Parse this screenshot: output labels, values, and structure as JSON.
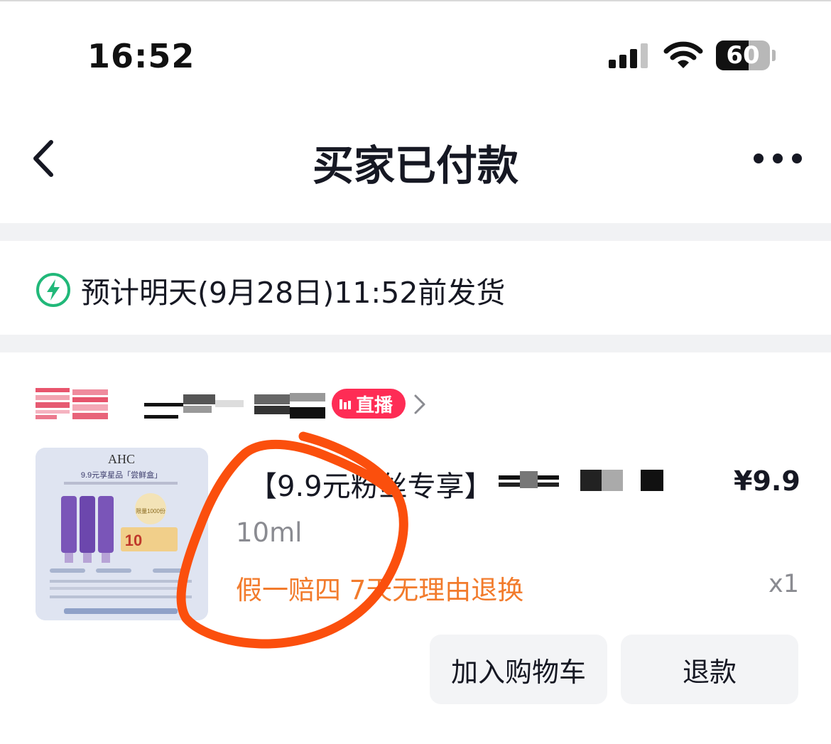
{
  "status_bar": {
    "time": "16:52",
    "battery": "60",
    "battery_level": 0.6,
    "signal_icon": "cellular-signal-icon",
    "wifi_icon": "wifi-icon"
  },
  "nav": {
    "title": "买家已付款",
    "back_icon": "chevron-left-icon",
    "more_icon": "more-dots-icon"
  },
  "shipping": {
    "icon": "lightning-bolt-icon",
    "text": "预计明天(9月28日)11:52前发货"
  },
  "shop": {
    "live_badge": "直播",
    "chevron_icon": "chevron-right-icon"
  },
  "product": {
    "image_brand": "AHC",
    "image_promo": "9.9元享星品「尝鲜盒」",
    "image_limit": "限量1000份",
    "image_coupon": "10",
    "title": "【9.9元粉丝专享】",
    "price": "¥9.9",
    "spec": "10ml",
    "tags": "假一赔四  7天无理由退换",
    "quantity": "x1"
  },
  "actions": {
    "add_to_cart": "加入购物车",
    "refund": "退款"
  },
  "colors": {
    "accent_red": "#fe2c55",
    "tag_orange": "#f27b2c",
    "bolt_green": "#21b879",
    "annotation_orange": "#fb4f0d"
  }
}
